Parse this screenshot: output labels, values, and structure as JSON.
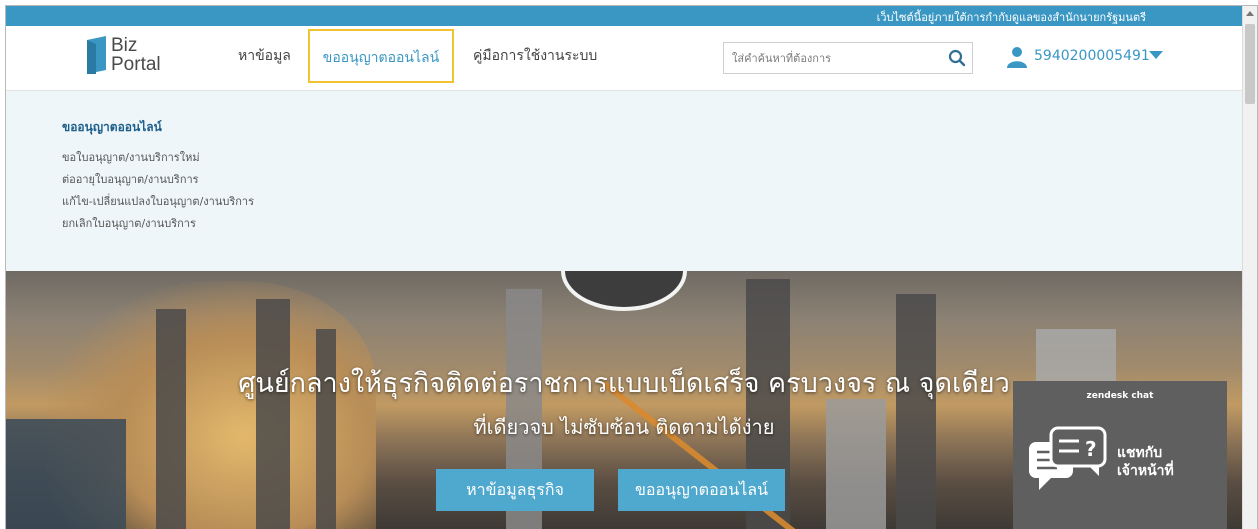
{
  "gov_notice": "เว็บไซต์นี้อยู่ภายใต้การกำกับดูแลของสำนักนายกรัฐมนตรี",
  "logo": {
    "line1": "Biz",
    "line2": "Portal"
  },
  "nav": {
    "items": [
      {
        "label": "หาข้อมูล"
      },
      {
        "label": "ขออนุญาตออนไลน์"
      },
      {
        "label": "คู่มือการใช้งานระบบ"
      }
    ]
  },
  "search": {
    "placeholder": "ใส่คำค้นหาที่ต้องการ",
    "value": ""
  },
  "user": {
    "id": "5940200005491"
  },
  "mega_menu": {
    "title": "ขออนุญาตออนไลน์",
    "items": [
      {
        "label": "ขอใบอนุญาต/งานบริการใหม่"
      },
      {
        "label": "ต่ออายุใบอนุญาต/งานบริการ"
      },
      {
        "label": "แก้ไข-เปลี่ยนแปลงใบอนุญาต/งานบริการ"
      },
      {
        "label": "ยกเลิกใบอนุญาต/งานบริการ"
      }
    ]
  },
  "hero": {
    "title": "ศูนย์กลางให้ธุรกิจติดต่อราชการแบบเบ็ดเสร็จ ครบวงจร ณ จุดเดียว",
    "subtitle": "ที่เดียวจบ ไม่ซับซ้อน ติดตามได้ง่าย",
    "buttons": [
      {
        "label": "หาข้อมูลธุรกิจ"
      },
      {
        "label": "ขออนุญาตออนไลน์"
      }
    ]
  },
  "chat": {
    "brand": "zendesk chat",
    "line1": "แชทกับ",
    "line2": "เจ้าหน้าที่"
  },
  "colors": {
    "primary": "#3a97c4",
    "highlight_border": "#f1c232",
    "hero_button": "#4fa9cf",
    "mega_bg": "#eef6f9",
    "chat_bg": "#5f5f5f"
  },
  "icons": {
    "logo": "bizportal-logo-icon",
    "search": "search-icon",
    "user": "user-icon",
    "caret": "caret-down-icon",
    "chat": "chat-bubble-icon"
  }
}
